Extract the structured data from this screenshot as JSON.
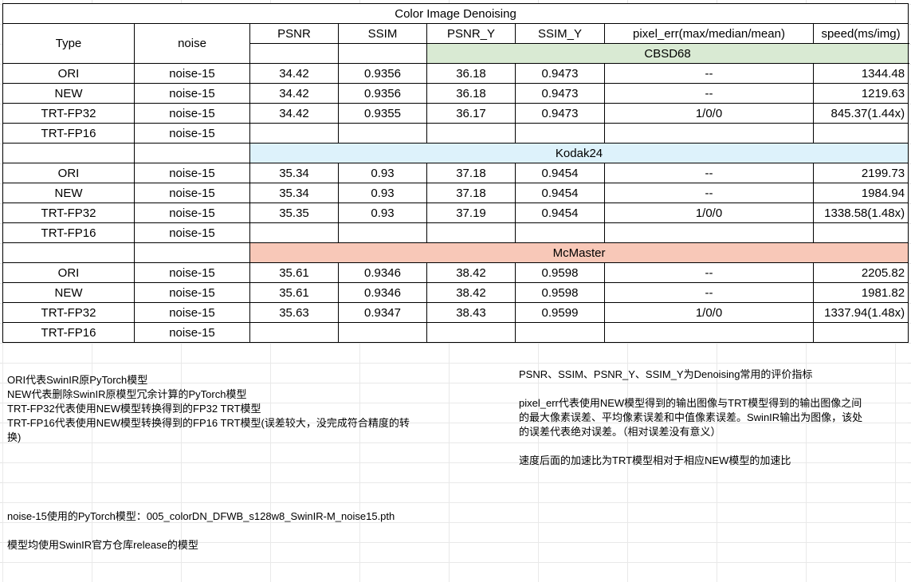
{
  "title": "Color Image Denoising",
  "headers": {
    "type": "Type",
    "noise": "noise",
    "psnr": "PSNR",
    "ssim": "SSIM",
    "psnr_y": "PSNR_Y",
    "ssim_y": "SSIM_Y",
    "pixel_err": "pixel_err(max/median/mean)",
    "speed": "speed(ms/img)"
  },
  "datasets": [
    {
      "name": "CBSD68",
      "color": "#d9ead3",
      "rows": [
        {
          "type": "ORI",
          "noise": "noise-15",
          "psnr": "34.42",
          "ssim": "0.9356",
          "psnr_y": "36.18",
          "ssim_y": "0.9473",
          "pixel_err": "--",
          "speed": "1344.48"
        },
        {
          "type": "NEW",
          "noise": "noise-15",
          "psnr": "34.42",
          "ssim": "0.9356",
          "psnr_y": "36.18",
          "ssim_y": "0.9473",
          "pixel_err": "--",
          "speed": "1219.63"
        },
        {
          "type": "TRT-FP32",
          "noise": "noise-15",
          "psnr": "34.42",
          "ssim": "0.9355",
          "psnr_y": "36.17",
          "ssim_y": "0.9473",
          "pixel_err": "1/0/0",
          "speed": "845.37(1.44x)"
        },
        {
          "type": "TRT-FP16",
          "noise": "noise-15",
          "psnr": "",
          "ssim": "",
          "psnr_y": "",
          "ssim_y": "",
          "pixel_err": "",
          "speed": ""
        }
      ]
    },
    {
      "name": "Kodak24",
      "color": "#ddf2fb",
      "rows": [
        {
          "type": "ORI",
          "noise": "noise-15",
          "psnr": "35.34",
          "ssim": "0.93",
          "psnr_y": "37.18",
          "ssim_y": "0.9454",
          "pixel_err": "--",
          "speed": "2199.73"
        },
        {
          "type": "NEW",
          "noise": "noise-15",
          "psnr": "35.34",
          "ssim": "0.93",
          "psnr_y": "37.18",
          "ssim_y": "0.9454",
          "pixel_err": "--",
          "speed": "1984.94"
        },
        {
          "type": "TRT-FP32",
          "noise": "noise-15",
          "psnr": "35.35",
          "ssim": "0.93",
          "psnr_y": "37.19",
          "ssim_y": "0.9454",
          "pixel_err": "1/0/0",
          "speed": "1338.58(1.48x)"
        },
        {
          "type": "TRT-FP16",
          "noise": "noise-15",
          "psnr": "",
          "ssim": "",
          "psnr_y": "",
          "ssim_y": "",
          "pixel_err": "",
          "speed": ""
        }
      ]
    },
    {
      "name": "McMaster",
      "color": "#f8c8b8",
      "rows": [
        {
          "type": "ORI",
          "noise": "noise-15",
          "psnr": "35.61",
          "ssim": "0.9346",
          "psnr_y": "38.42",
          "ssim_y": "0.9598",
          "pixel_err": "--",
          "speed": "2205.82"
        },
        {
          "type": "NEW",
          "noise": "noise-15",
          "psnr": "35.61",
          "ssim": "0.9346",
          "psnr_y": "38.42",
          "ssim_y": "0.9598",
          "pixel_err": "--",
          "speed": "1981.82"
        },
        {
          "type": "TRT-FP32",
          "noise": "noise-15",
          "psnr": "35.63",
          "ssim": "0.9347",
          "psnr_y": "38.43",
          "ssim_y": "0.9599",
          "pixel_err": "1/0/0",
          "speed": "1337.94(1.48x)"
        },
        {
          "type": "TRT-FP16",
          "noise": "noise-15",
          "psnr": "",
          "ssim": "",
          "psnr_y": "",
          "ssim_y": "",
          "pixel_err": "",
          "speed": ""
        }
      ]
    }
  ],
  "notes_left": [
    "ORI代表SwinIR原PyTorch模型",
    "NEW代表删除SwinIR原模型冗余计算的PyTorch模型",
    "TRT-FP32代表使用NEW模型转换得到的FP32 TRT模型",
    "TRT-FP16代表使用NEW模型转换得到的FP16 TRT模型(误差较大，没完成符合精度的转换)"
  ],
  "notes_right": [
    "PSNR、SSIM、PSNR_Y、SSIM_Y为Denoising常用的评价指标",
    "pixel_err代表使用NEW模型得到的输出图像与TRT模型得到的输出图像之间的最大像素误差、平均像素误差和中值像素误差。SwinIR输出为图像，该处的误差代表绝对误差。（相对误差没有意义）",
    "速度后面的加速比为TRT模型相对于相应NEW模型的加速比"
  ],
  "notes_bottom": [
    "noise-15使用的PyTorch模型：005_colorDN_DFWB_s128w8_SwinIR-M_noise15.pth",
    "模型均使用SwinIR官方仓库release的模型"
  ]
}
